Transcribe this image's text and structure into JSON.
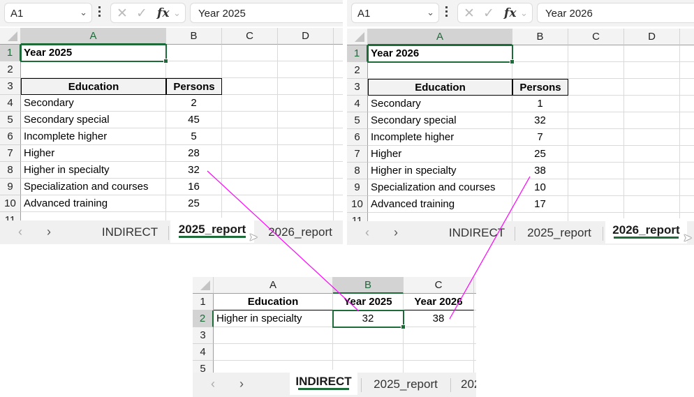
{
  "panels": {
    "report2025": {
      "name_box": "A1",
      "formula": "Year 2025",
      "columns": [
        "A",
        "B",
        "C",
        "D"
      ],
      "rows": [
        "1",
        "2",
        "3",
        "4",
        "5",
        "6",
        "7",
        "8",
        "9",
        "10",
        "11"
      ],
      "title": "Year 2025",
      "table_headers": [
        "Education",
        "Persons"
      ],
      "table_rows": [
        [
          "Secondary",
          "2"
        ],
        [
          "Secondary special",
          "45"
        ],
        [
          "Incomplete higher",
          "5"
        ],
        [
          "Higher",
          "28"
        ],
        [
          "Higher in specialty",
          "32"
        ],
        [
          "Specialization and courses",
          "16"
        ],
        [
          "Advanced training",
          "25"
        ]
      ],
      "sheet_tabs": [
        "INDIRECT",
        "2025_report",
        "2026_report"
      ],
      "active_tab": "2025_report"
    },
    "report2026": {
      "name_box": "A1",
      "formula": "Year 2026",
      "columns": [
        "A",
        "B",
        "C",
        "D"
      ],
      "rows": [
        "1",
        "2",
        "3",
        "4",
        "5",
        "6",
        "7",
        "8",
        "9",
        "10",
        "11"
      ],
      "title": "Year 2026",
      "table_headers": [
        "Education",
        "Persons"
      ],
      "table_rows": [
        [
          "Secondary",
          "1"
        ],
        [
          "Secondary special",
          "32"
        ],
        [
          "Incomplete higher",
          "7"
        ],
        [
          "Higher",
          "25"
        ],
        [
          "Higher in specialty",
          "38"
        ],
        [
          "Specialization and courses",
          "10"
        ],
        [
          "Advanced training",
          "17"
        ]
      ],
      "sheet_tabs": [
        "INDIRECT",
        "2025_report",
        "2026_report"
      ],
      "active_tab": "2026_report"
    },
    "indirect": {
      "columns": [
        "A",
        "B",
        "C"
      ],
      "rows": [
        "1",
        "2",
        "3",
        "4",
        "5"
      ],
      "headers": [
        "Education",
        "Year 2025",
        "Year 2026"
      ],
      "row2": [
        "Higher in specialty",
        "32",
        "38"
      ],
      "sheet_tabs": [
        "INDIRECT",
        "2025_report",
        "202"
      ],
      "active_tab": "INDIRECT"
    }
  },
  "icons": {
    "chevron_down": "⌄",
    "cancel": "✕",
    "enter": "✓",
    "fx": "fx",
    "prev": "‹",
    "next": "›",
    "cursor": "➤"
  },
  "colors": {
    "selection": "#1e6b3a",
    "arrow": "#ff00ff"
  }
}
